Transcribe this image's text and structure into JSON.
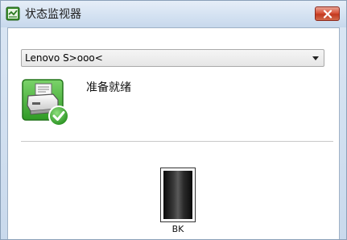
{
  "window": {
    "title": "状态监视器"
  },
  "printer_select": {
    "selected": "Lenovo S>ooo<"
  },
  "status": {
    "message": "准备就绪",
    "icon": "printer-ready-icon",
    "color": "#2e9e2e"
  },
  "toner": {
    "label": "BK",
    "level": 1.0
  },
  "colors": {
    "close_button": "#d9543b",
    "titlebar": "#d3e1f1"
  }
}
